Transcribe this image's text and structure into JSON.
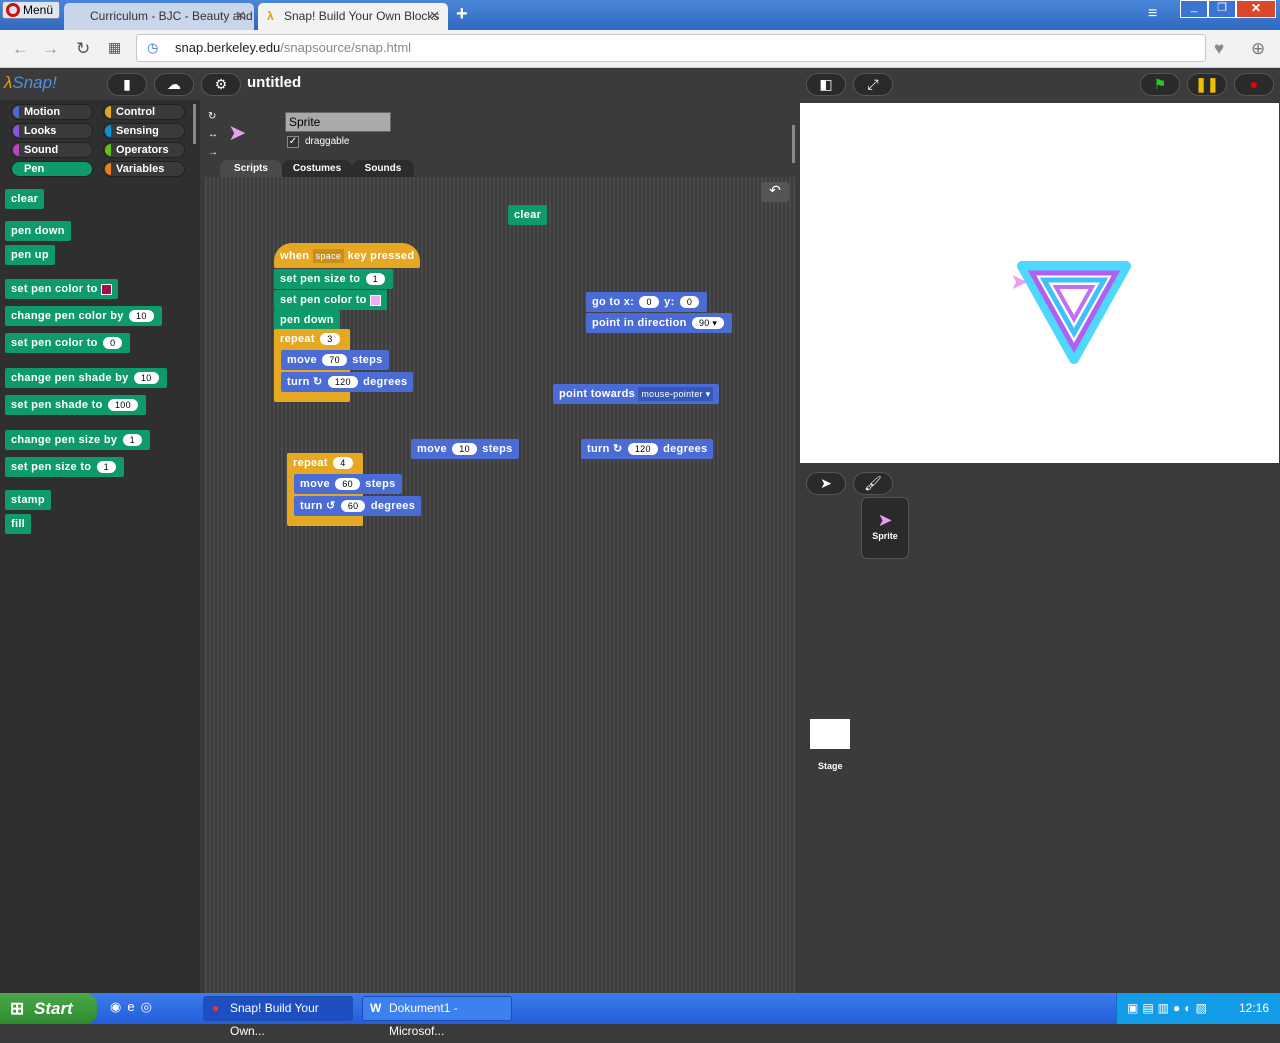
{
  "browser": {
    "menu_label": "Menü",
    "tabs": [
      {
        "title": "Curriculum - BJC - Beauty and",
        "active": false
      },
      {
        "title": "Snap! Build Your Own Blocks",
        "active": true
      }
    ],
    "url_host": "snap.berkeley.edu",
    "url_path": "/snapsource/snap.html"
  },
  "snap": {
    "logo": "Snap!",
    "project_title": "untitled",
    "categories": [
      "Motion",
      "Control",
      "Looks",
      "Sensing",
      "Sound",
      "Operators",
      "Pen",
      "Variables"
    ],
    "category_colors": {
      "Motion": "#4a6cd4",
      "Control": "#e6a822",
      "Looks": "#8a55d7",
      "Sensing": "#0494dc",
      "Sound": "#bb42c3",
      "Operators": "#62c213",
      "Pen": "#0e9a6c",
      "Variables": "#ee7d16"
    },
    "selected_category": "Pen",
    "palette": [
      {
        "text": "clear"
      },
      {
        "text": "pen down"
      },
      {
        "text": "pen up"
      },
      {
        "text": "set pen color to",
        "swatch": "#a0104a"
      },
      {
        "text": "change pen color by",
        "value": "10"
      },
      {
        "text": "set pen color to",
        "value": "0"
      },
      {
        "text": "change pen shade by",
        "value": "10"
      },
      {
        "text": "set pen shade to",
        "value": "100"
      },
      {
        "text": "change pen size by",
        "value": "1"
      },
      {
        "text": "set pen size to",
        "value": "1"
      },
      {
        "text": "stamp"
      },
      {
        "text": "fill"
      }
    ],
    "sprite": {
      "name": "Sprite",
      "draggable_label": "draggable",
      "draggable": true
    },
    "tabs": [
      "Scripts",
      "Costumes",
      "Sounds"
    ],
    "scripts": {
      "clear": "clear",
      "hat": {
        "when": "when",
        "key": "space",
        "rest": "key pressed"
      },
      "set_size": {
        "text": "set pen size to",
        "value": "1"
      },
      "set_color": {
        "text": "set pen color to",
        "swatch": "#f2a8f2"
      },
      "pen_down": "pen down",
      "repeat1": {
        "text": "repeat",
        "value": "3"
      },
      "move1": {
        "a": "move",
        "value": "70",
        "b": "steps"
      },
      "turn1": {
        "a": "turn",
        "value": "120",
        "b": "degrees"
      },
      "goto": {
        "a": "go to x:",
        "x": "0",
        "b": "y:",
        "y": "0"
      },
      "point_dir": {
        "text": "point in direction",
        "value": "90"
      },
      "point_towards": {
        "text": "point towards",
        "value": "mouse-pointer"
      },
      "move2": {
        "a": "move",
        "value": "10",
        "b": "steps"
      },
      "turn2": {
        "a": "turn",
        "value": "120",
        "b": "degrees"
      },
      "repeat2": {
        "text": "repeat",
        "value": "4"
      },
      "move3": {
        "a": "move",
        "value": "60",
        "b": "steps"
      },
      "turn3": {
        "a": "turn",
        "value": "60",
        "b": "degrees"
      }
    },
    "corral": {
      "sprite_label": "Sprite",
      "stage_label": "Stage"
    }
  },
  "taskbar": {
    "start": "Start",
    "items": [
      "Snap! Build Your Own...",
      "Dokument1 - Microsof..."
    ],
    "clock": "12:16"
  }
}
